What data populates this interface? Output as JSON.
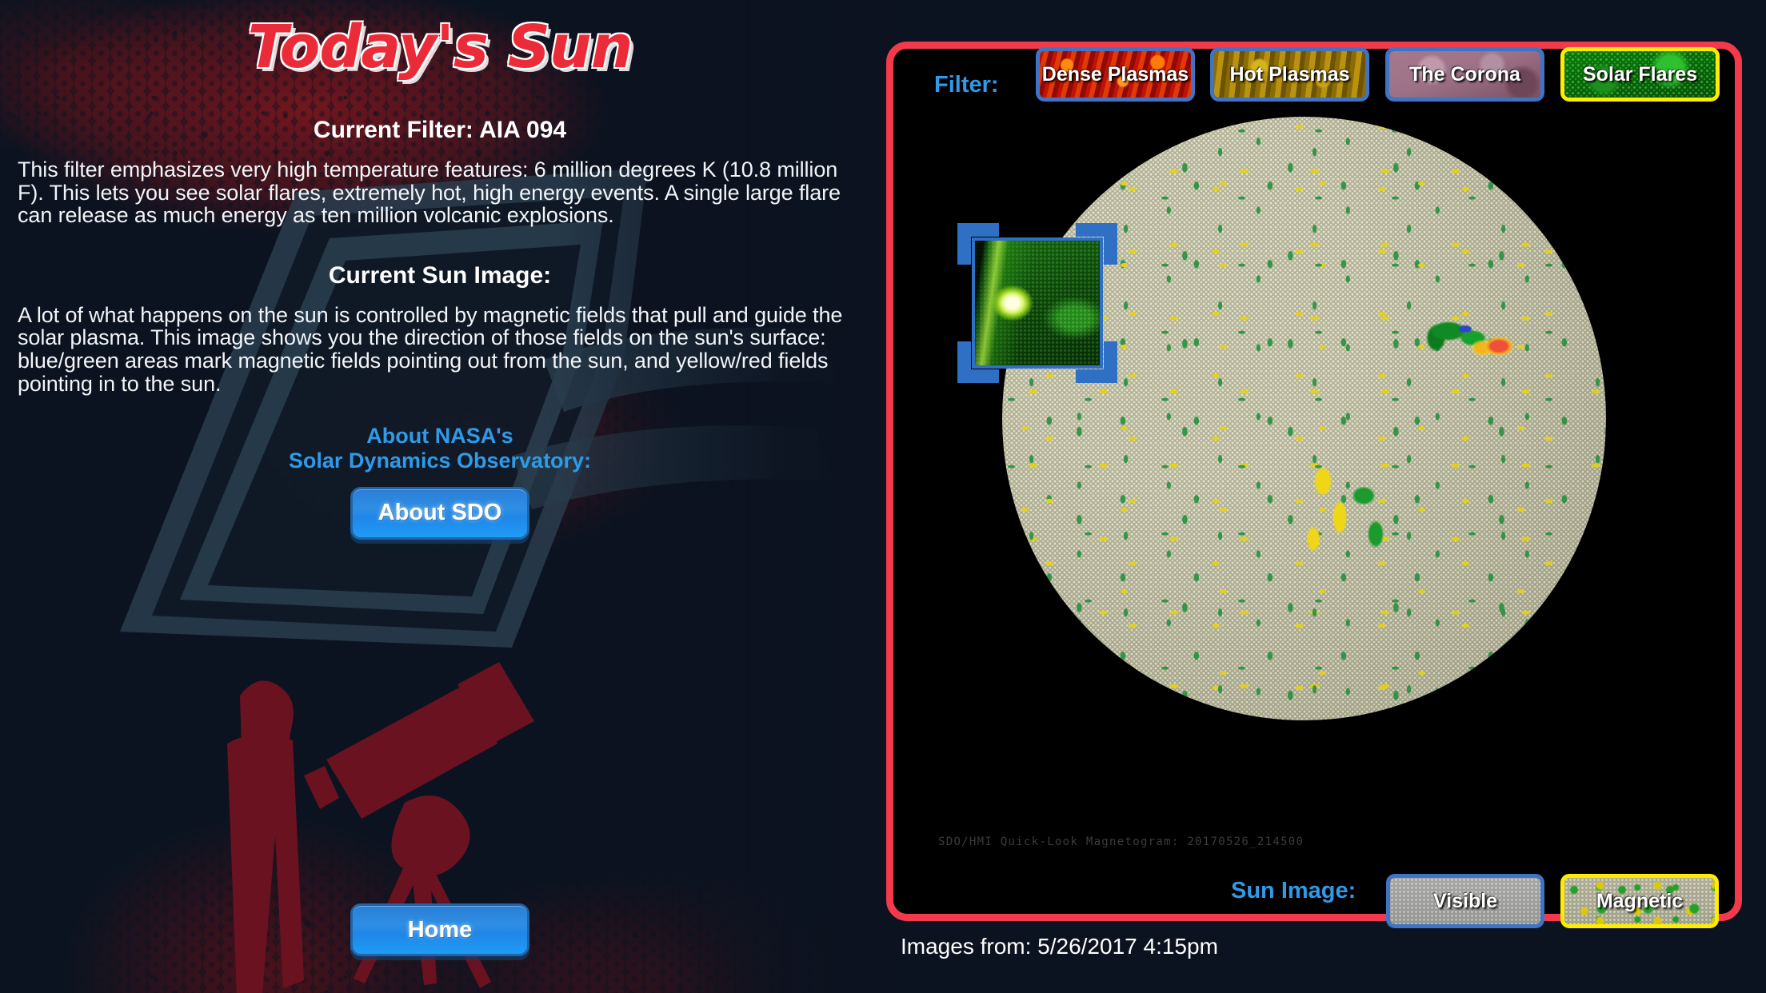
{
  "page": {
    "title": "Today's Sun",
    "accent_red": "#ec2b39",
    "accent_blue": "#2f9ae8",
    "panel_border": "#f23a4c",
    "selected_border": "#ffec00"
  },
  "left": {
    "filter_heading": "Current Filter: AIA 094",
    "filter_paragraph": "This filter emphasizes very high temperature features: 6 million degrees K (10.8 million F).  This lets you see solar flares, extremely hot, high energy events.  A single large flare can release as much energy as ten million volcanic explosions.",
    "image_heading": "Current Sun Image:",
    "image_paragraph": "A lot of what happens on the sun is controlled by magnetic fields that pull and guide the solar plasma. This image shows you the direction of those fields on the sun's surface: blue/green areas mark magnetic fields pointing out from the sun, and yellow/red fields pointing in to the sun.",
    "about_line1": "About NASA's",
    "about_line2": "Solar Dynamics Observatory:",
    "about_button": "About SDO",
    "home_button": "Home"
  },
  "panel": {
    "filter_label": "Filter:",
    "sun_image_label": "Sun Image:",
    "filters": [
      {
        "label": "Dense Plasmas",
        "texture": "tex-dense",
        "selected": false
      },
      {
        "label": "Hot Plasmas",
        "texture": "tex-hot",
        "selected": false
      },
      {
        "label": "The Corona",
        "texture": "tex-corona",
        "selected": false
      },
      {
        "label": "Solar Flares",
        "texture": "tex-flares",
        "selected": true
      }
    ],
    "sun_image_modes": [
      {
        "label": "Visible",
        "texture": "tex-visible",
        "selected": false
      },
      {
        "label": "Magnetic",
        "texture": "tex-magnetic",
        "selected": true
      }
    ],
    "sun_caption": "SDO/HMI Quick-Look Magnetogram:  20170526_214500",
    "date_line": "Images from: 5/26/2017 4:15pm"
  }
}
